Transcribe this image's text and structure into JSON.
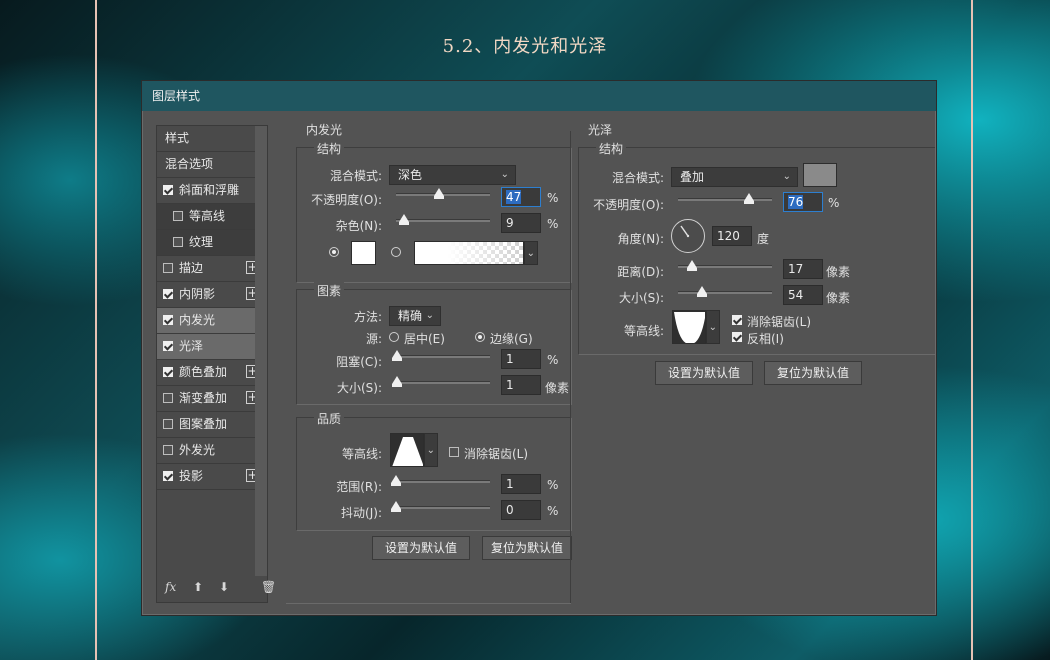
{
  "page": {
    "heading": "5.2、内发光和光泽"
  },
  "dialog": {
    "title": "图层样式",
    "sidebar": {
      "items": [
        {
          "label": "样式",
          "checkbox": false,
          "checked": false,
          "plus": false,
          "selected": false,
          "sub": false
        },
        {
          "label": "混合选项",
          "checkbox": false,
          "checked": false,
          "plus": false,
          "selected": false,
          "sub": false
        },
        {
          "label": "斜面和浮雕",
          "checkbox": true,
          "checked": true,
          "plus": false,
          "selected": false,
          "sub": false
        },
        {
          "label": "等高线",
          "checkbox": true,
          "checked": false,
          "plus": false,
          "selected": false,
          "sub": true
        },
        {
          "label": "纹理",
          "checkbox": true,
          "checked": false,
          "plus": false,
          "selected": false,
          "sub": true
        },
        {
          "label": "描边",
          "checkbox": true,
          "checked": false,
          "plus": true,
          "selected": false,
          "sub": false
        },
        {
          "label": "内阴影",
          "checkbox": true,
          "checked": true,
          "plus": true,
          "selected": false,
          "sub": false
        },
        {
          "label": "内发光",
          "checkbox": true,
          "checked": true,
          "plus": false,
          "selected": true,
          "sub": false
        },
        {
          "label": "光泽",
          "checkbox": true,
          "checked": true,
          "plus": false,
          "selected": true,
          "sub": false
        },
        {
          "label": "颜色叠加",
          "checkbox": true,
          "checked": true,
          "plus": true,
          "selected": false,
          "sub": false
        },
        {
          "label": "渐变叠加",
          "checkbox": true,
          "checked": false,
          "plus": true,
          "selected": false,
          "sub": false
        },
        {
          "label": "图案叠加",
          "checkbox": true,
          "checked": false,
          "plus": false,
          "selected": false,
          "sub": false
        },
        {
          "label": "外发光",
          "checkbox": true,
          "checked": false,
          "plus": false,
          "selected": false,
          "sub": false
        },
        {
          "label": "投影",
          "checkbox": true,
          "checked": true,
          "plus": true,
          "selected": false,
          "sub": false
        }
      ],
      "footer": {
        "fx": "fx",
        "up_icon": "arrow-up-icon",
        "down_icon": "arrow-down-icon",
        "trash_icon": "trash-icon"
      }
    },
    "inner_glow": {
      "title": "内发光",
      "structure_title": "结构",
      "blend_mode_label": "混合模式:",
      "blend_mode_value": "深色",
      "opacity_label": "不透明度(O):",
      "opacity_value": "47",
      "opacity_unit": "%",
      "noise_label": "杂色(N):",
      "noise_value": "9",
      "noise_unit": "%",
      "elements_title": "图素",
      "method_label": "方法:",
      "method_value": "精确",
      "source_label": "源:",
      "source_center": "居中(E)",
      "source_edge": "边缘(G)",
      "choke_label": "阻塞(C):",
      "choke_value": "1",
      "choke_unit": "%",
      "size_label": "大小(S):",
      "size_value": "1",
      "size_unit": "像素",
      "quality_title": "品质",
      "contour_label": "等高线:",
      "anti_alias_label": "消除锯齿(L)",
      "range_label": "范围(R):",
      "range_value": "1",
      "range_unit": "%",
      "jitter_label": "抖动(J):",
      "jitter_value": "0",
      "jitter_unit": "%",
      "set_default": "设置为默认值",
      "reset_default": "复位为默认值"
    },
    "satin": {
      "title": "光泽",
      "structure_title": "结构",
      "blend_mode_label": "混合模式:",
      "blend_mode_value": "叠加",
      "color": "#8a8a8a",
      "opacity_label": "不透明度(O):",
      "opacity_value": "76",
      "opacity_unit": "%",
      "angle_label": "角度(N):",
      "angle_value": "120",
      "angle_unit": "度",
      "distance_label": "距离(D):",
      "distance_value": "17",
      "distance_unit": "像素",
      "size_label": "大小(S):",
      "size_value": "54",
      "size_unit": "像素",
      "contour_label": "等高线:",
      "anti_alias_label": "消除锯齿(L)",
      "invert_label": "反相(I)",
      "set_default": "设置为默认值",
      "reset_default": "复位为默认值"
    }
  }
}
